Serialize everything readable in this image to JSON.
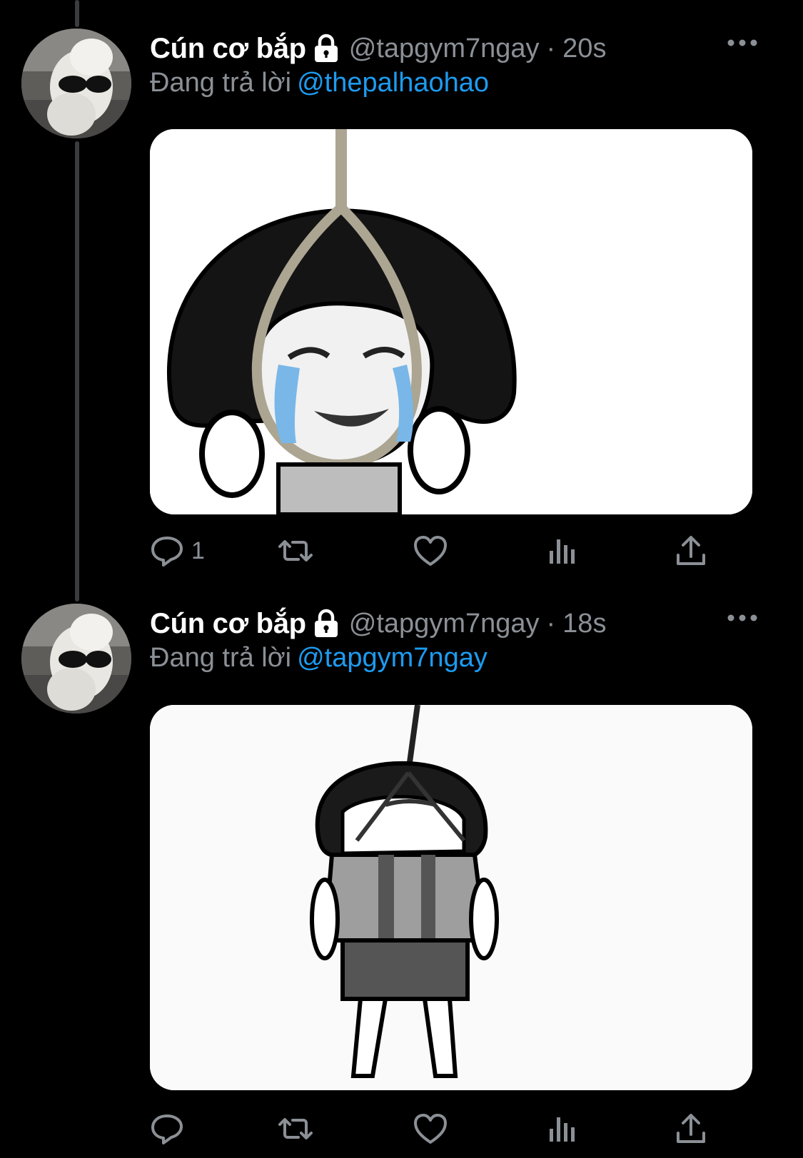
{
  "colors": {
    "background": "#000000",
    "name": "#ffffff",
    "secondary_text": "#8b9096",
    "mention": "#1d9bf0",
    "thread_line": "#3a3d40"
  },
  "tweets": [
    {
      "author_name": "Cún cơ bắp",
      "handle": "@tapgym7ngay",
      "separator": "·",
      "time": "20s",
      "reply_prefix": "Đang trả lời",
      "reply_to": "@thepalhaohao",
      "media_icon": "meme-image-noose-crying",
      "reply_count": "1",
      "icons": [
        "lock-icon",
        "more-icon",
        "reply-icon",
        "retweet-icon",
        "like-icon",
        "views-icon",
        "share-icon"
      ]
    },
    {
      "author_name": "Cún cơ bắp",
      "handle": "@tapgym7ngay",
      "separator": "·",
      "time": "18s",
      "reply_prefix": "Đang trả lời",
      "reply_to": "@tapgym7ngay",
      "media_icon": "meme-image-hanging-back",
      "reply_count": "",
      "icons": [
        "lock-icon",
        "more-icon",
        "reply-icon",
        "retweet-icon",
        "like-icon",
        "views-icon",
        "share-icon"
      ]
    }
  ]
}
